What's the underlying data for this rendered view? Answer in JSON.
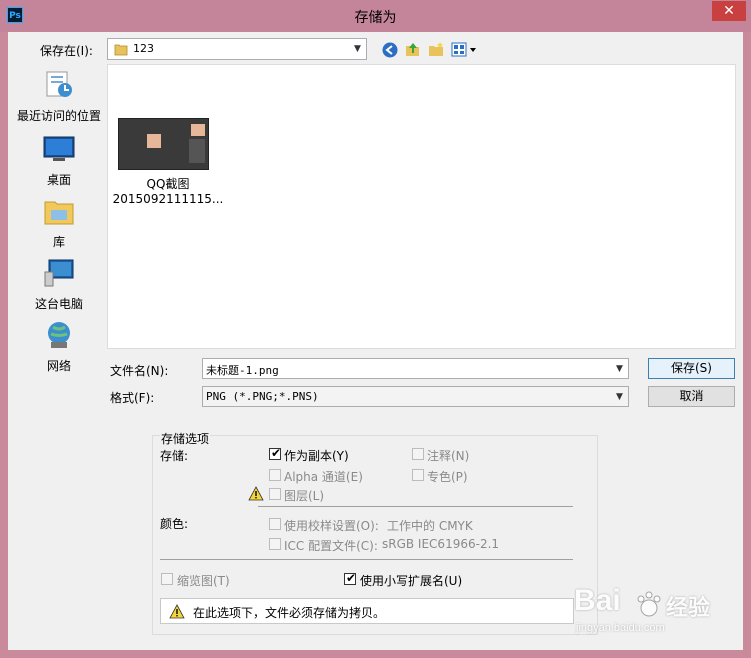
{
  "window": {
    "app_icon_text": "Ps",
    "title": "存储为",
    "close_glyph": "✕"
  },
  "save_in": {
    "label": "保存在(I):",
    "folder": "123"
  },
  "places": [
    {
      "label": "最近访问的位置",
      "icon": "recent-places-icon"
    },
    {
      "label": "桌面",
      "icon": "desktop-icon"
    },
    {
      "label": "库",
      "icon": "libraries-icon"
    },
    {
      "label": "这台电脑",
      "icon": "this-pc-icon"
    },
    {
      "label": "网络",
      "icon": "network-icon"
    }
  ],
  "files": [
    {
      "name_line1": "QQ截图",
      "name_line2": "2015092111115..."
    }
  ],
  "filename": {
    "label": "文件名(N):",
    "value": "未标题-1.png"
  },
  "format": {
    "label": "格式(F):",
    "value": "PNG (*.PNG;*.PNS)"
  },
  "buttons": {
    "save": "保存(S)",
    "cancel": "取消"
  },
  "save_options": {
    "group_title": "存储选项",
    "store_label": "存储:",
    "as_copy": {
      "label": "作为副本(Y)",
      "checked": true
    },
    "notes": {
      "label": "注释(N)",
      "checked": false
    },
    "alpha": {
      "label": "Alpha 通道(E)",
      "checked": false
    },
    "spot": {
      "label": "专色(P)",
      "checked": false
    },
    "layers": {
      "label": "图层(L)",
      "checked": false
    },
    "color_label": "颜色:",
    "proof": {
      "label": "使用校样设置(O):",
      "value": "工作中的 CMYK",
      "checked": false
    },
    "icc": {
      "label": "ICC 配置文件(C):",
      "value": "sRGB IEC61966-2.1",
      "checked": false
    },
    "thumbnail": {
      "label": "缩览图(T)",
      "checked": false
    },
    "lowercase_ext": {
      "label": "使用小写扩展名(U)",
      "checked": true
    },
    "warning": "在此选项下，文件必须存储为拷贝。"
  },
  "watermark": {
    "brand": "Bai",
    "brand2": "经验",
    "url": "jingyan.baidu.com"
  },
  "colors": {
    "frame": "#c4859a",
    "close": "#c94040",
    "accent": "#3c7fb1"
  }
}
